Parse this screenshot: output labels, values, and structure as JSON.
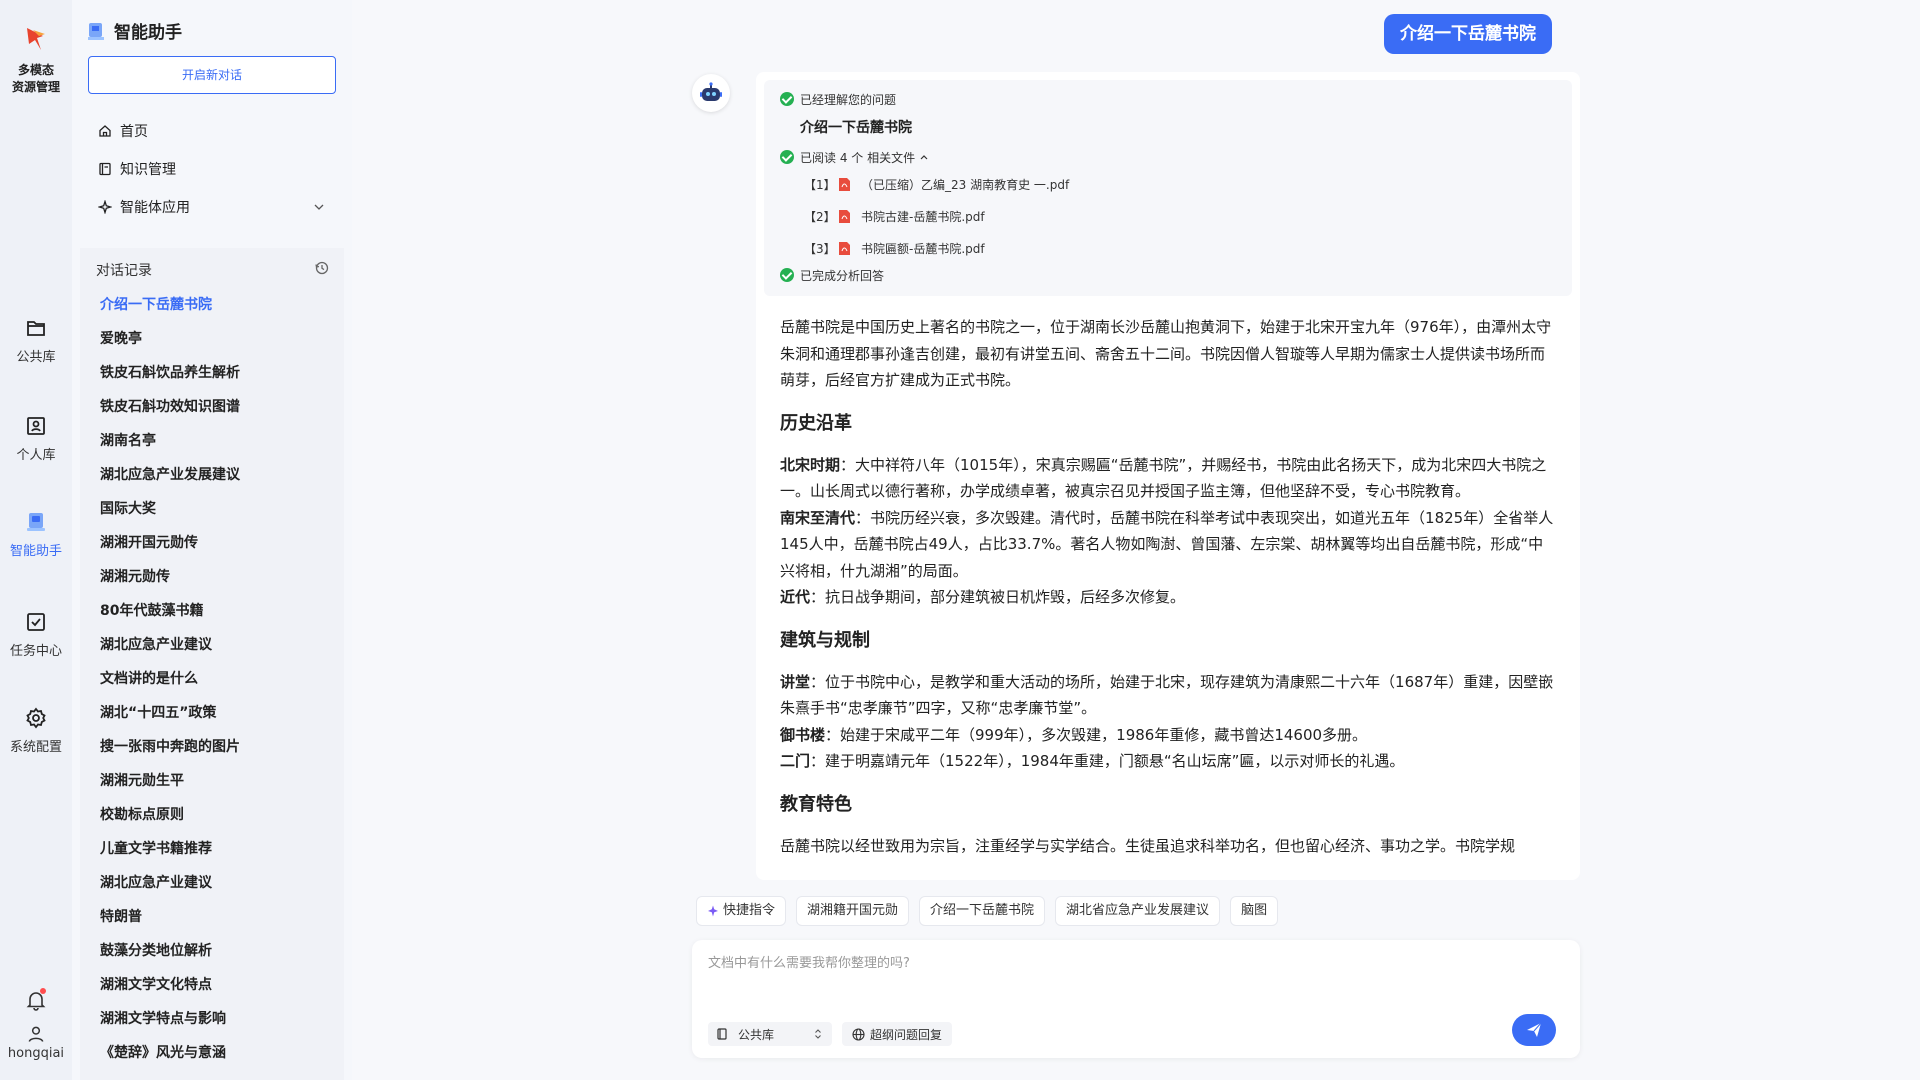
{
  "rail": {
    "brand_line1": "多模态",
    "brand_line2": "资源管理",
    "items": [
      {
        "label": "公共库"
      },
      {
        "label": "个人库"
      },
      {
        "label": "智能助手"
      },
      {
        "label": "任务中心"
      },
      {
        "label": "系统配置"
      }
    ],
    "username": "hongqiai",
    "accent": "#3a6cf5"
  },
  "sidebar": {
    "title": "智能助手",
    "new_chat": "开启新对话",
    "nav": [
      {
        "label": "首页",
        "icon": "home-icon"
      },
      {
        "label": "知识管理",
        "icon": "book-icon"
      },
      {
        "label": "智能体应用",
        "icon": "sparkle-icon"
      }
    ],
    "history_title": "对话记录",
    "history": [
      "介绍一下岳麓书院",
      "爱晚亭",
      "铁皮石斛饮品养生解析",
      "铁皮石斛功效知识图谱",
      "湖南名亭",
      "湖北应急产业发展建议",
      "国际大奖",
      "湖湘开国元勋传",
      "湖湘元勋传",
      "80年代鼓藻书籍",
      "湖北应急产业建议",
      "文档讲的是什么",
      "湖北“十四五”政策",
      "搜一张雨中奔跑的图片",
      "湖湘元勋生平",
      "校勘标点原则",
      "儿童文学书籍推荐",
      "湖北应急产业建议",
      "特朗普",
      "鼓藻分类地位解析",
      "湖湘文学文化特点",
      "湖湘文学特点与影响",
      "《楚辞》风光与意涵"
    ]
  },
  "chat": {
    "user_message": "介绍一下岳麓书院",
    "steps": {
      "understood": "已经理解您的问题",
      "query": "介绍一下岳麓书院",
      "read_prefix": "已阅读 4 个 相关文件",
      "files": [
        {
          "idx": "【1】",
          "name": "（已压缩）乙编_23 湖南教育史 一.pdf"
        },
        {
          "idx": "【2】",
          "name": "书院古建-岳麓书院.pdf"
        },
        {
          "idx": "【3】",
          "name": "书院匾额-岳麓书院.pdf"
        }
      ],
      "done": "已完成分析回答"
    },
    "answer": {
      "intro": "岳麓书院是中国历史上著名的书院之一，位于湖南长沙岳麓山抱黄洞下，始建于北宋开宝九年（976年），由潭州太守朱洞和通理郡事孙逢吉创建，最初有讲堂五间、斋舍五十二间。书院因僧人智璇等人早期为儒家士人提供读书场所而萌芽，后经官方扩建成为正式书院。",
      "h1": "历史沿革",
      "s1": [
        {
          "label": "北宋时期",
          "text": "：大中祥符八年（1015年），宋真宗赐匾“岳麓书院”，并赐经书，书院由此名扬天下，成为北宋四大书院之一。山长周式以德行著称，办学成绩卓著，被真宗召见并授国子监主簿，但他坚辞不受，专心书院教育。"
        },
        {
          "label": "南宋至清代",
          "text": "：书院历经兴衰，多次毁建。清代时，岳麓书院在科举考试中表现突出，如道光五年（1825年）全省举人145人中，岳麓书院占49人，占比33.7%。著名人物如陶澍、曾国藩、左宗棠、胡林翼等均出自岳麓书院，形成“中兴将相，什九湖湘”的局面。"
        },
        {
          "label": "近代",
          "text": "：抗日战争期间，部分建筑被日机炸毁，后经多次修复。"
        }
      ],
      "h2": "建筑与规制",
      "s2": [
        {
          "label": "讲堂",
          "text": "：位于书院中心，是教学和重大活动的场所，始建于北宋，现存建筑为清康熙二十六年（1687年）重建，因壁嵌朱熹手书“忠孝廉节”四字，又称“忠孝廉节堂”。"
        },
        {
          "label": "御书楼",
          "text": "：始建于宋咸平二年（999年），多次毁建，1986年重修，藏书曾达14600多册。"
        },
        {
          "label": "二门",
          "text": "：建于明嘉靖元年（1522年），1984年重建，门额悬“名山坛席”匾，以示对师长的礼遇。"
        }
      ],
      "h3": "教育特色",
      "s3": "岳麓书院以经世致用为宗旨，注重经学与实学结合。生徒虽追求科举功名，但也留心经济、事功之学。书院学规"
    }
  },
  "chips": [
    "快捷指令",
    "湖湘籍开国元勋",
    "介绍一下岳麓书院",
    "湖北省应急产业发展建议",
    "脑图"
  ],
  "composer": {
    "placeholder": "文档中有什么需要我帮你整理的吗?",
    "library": "公共库",
    "web_search": "超纲问题回复"
  }
}
